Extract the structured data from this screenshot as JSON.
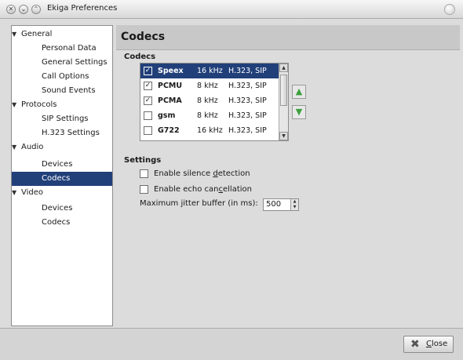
{
  "window": {
    "title": "Ekiga Preferences",
    "controls": [
      "close-icon",
      "minimize-icon",
      "maximize-icon"
    ]
  },
  "sidebar": {
    "categories": [
      {
        "label": "General",
        "children": [
          "Personal Data",
          "General Settings",
          "Call Options",
          "Sound Events"
        ]
      },
      {
        "label": "Protocols",
        "children": [
          "SIP Settings",
          "H.323 Settings"
        ]
      },
      {
        "label": "Audio",
        "children": [
          "Devices",
          "Codecs"
        ]
      },
      {
        "label": "Video",
        "children": [
          "Devices",
          "Codecs"
        ]
      }
    ],
    "selected": "Audio / Codecs"
  },
  "page": {
    "title": "Codecs",
    "codecs_section": "Codecs",
    "codecs": [
      {
        "name": "Speex",
        "rate": "16 kHz",
        "protocols": "H.323, SIP",
        "enabled": true,
        "selected": true
      },
      {
        "name": "PCMU",
        "rate": "8 kHz",
        "protocols": "H.323, SIP",
        "enabled": true,
        "selected": false
      },
      {
        "name": "PCMA",
        "rate": "8 kHz",
        "protocols": "H.323, SIP",
        "enabled": true,
        "selected": false
      },
      {
        "name": "gsm",
        "rate": "8 kHz",
        "protocols": "H.323, SIP",
        "enabled": false,
        "selected": false
      },
      {
        "name": "G722",
        "rate": "16 kHz",
        "protocols": "H.323, SIP",
        "enabled": false,
        "selected": false
      }
    ],
    "move_buttons": [
      "arrow-up-icon",
      "arrow-down-icon"
    ],
    "settings_section": "Settings",
    "silence_detection": {
      "label_pre": "Enable silence ",
      "label_u": "d",
      "label_post": "etection",
      "checked": false
    },
    "echo_cancellation": {
      "label_pre": "Enable echo can",
      "label_u": "c",
      "label_post": "ellation",
      "checked": false
    },
    "jitter": {
      "label": "Maximum jitter buffer (in ms):",
      "value": "500"
    }
  },
  "footer": {
    "close_label_u": "C",
    "close_label_rest": "lose"
  },
  "colors": {
    "selection": "#21407a",
    "arrow_green": "#3da03d"
  }
}
